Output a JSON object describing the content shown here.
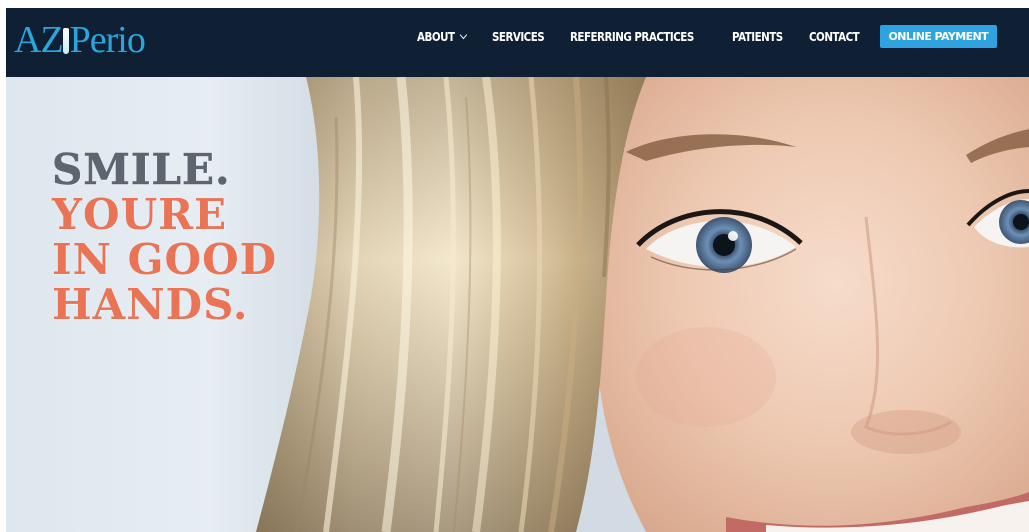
{
  "header": {
    "logo": {
      "az": "AZ",
      "perio": "Perio"
    },
    "nav": {
      "items": [
        {
          "label": "ABOUT",
          "has_dropdown": true
        },
        {
          "label": "SERVICES",
          "has_dropdown": false
        },
        {
          "label": "REFERRING PRACTICES",
          "has_dropdown": false
        },
        {
          "label": "PATIENTS",
          "has_dropdown": false
        },
        {
          "label": "CONTACT",
          "has_dropdown": false
        }
      ],
      "payment_button": "ONLINE PAYMENT"
    }
  },
  "hero": {
    "tagline": [
      "SMILE.",
      "YOURE",
      "IN GOOD",
      "HANDS."
    ]
  },
  "colors": {
    "header_bg": "#0f1f34",
    "brand_blue": "#2aa6dc",
    "payment_button": "#2ea3e0",
    "tagline_gray": "#5d6570",
    "tagline_orange": "#e96847"
  },
  "icons": {
    "dropdown": "chevron-down-icon",
    "hero_image": "smiling-woman-photo"
  }
}
